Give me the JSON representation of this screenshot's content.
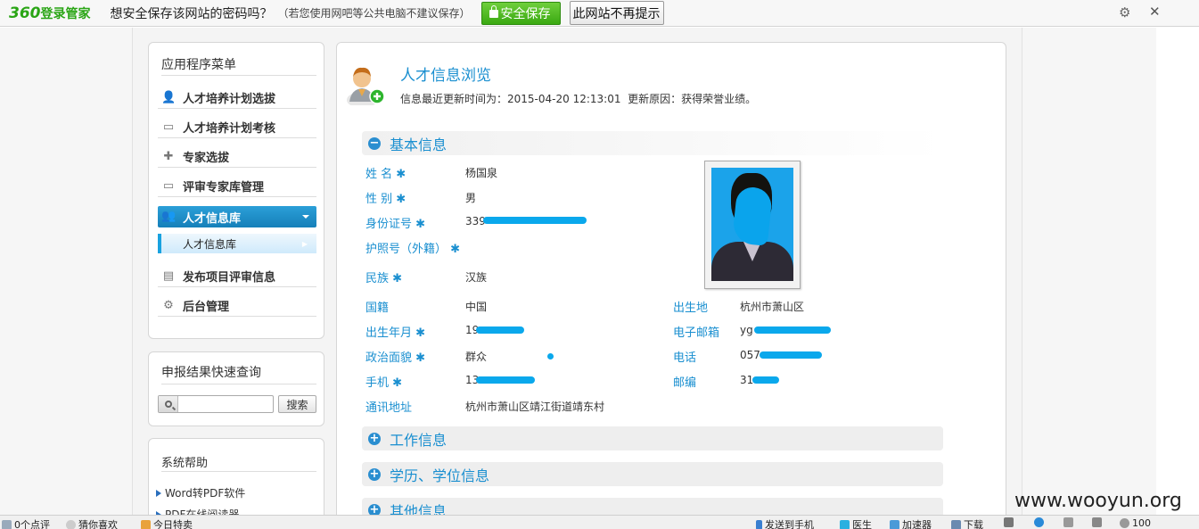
{
  "password_bar": {
    "logo_number": "360",
    "logo_text": "登录管家",
    "question": "想安全保存该网站的密码吗？",
    "hint": "（若您使用网吧等公共电脑不建议保存）",
    "save_button": "安全保存",
    "never_button": "此网站不再提示"
  },
  "sidebar": {
    "menu_title": "应用程序菜单",
    "items": [
      {
        "label": "人才培养计划选拔",
        "icon": "user-icon"
      },
      {
        "label": "人才培养计划考核",
        "icon": "monitor-icon"
      },
      {
        "label": "专家选拔",
        "icon": "puzzle-icon"
      },
      {
        "label": "评审专家库管理",
        "icon": "monitor-icon"
      },
      {
        "label": "人才信息库",
        "icon": "users-icon",
        "active": true
      },
      {
        "label": "发布项目评审信息",
        "icon": "document-icon"
      },
      {
        "label": "后台管理",
        "icon": "gear-icon"
      }
    ],
    "sub_item": "人才信息库",
    "query_title": "申报结果快速查询",
    "search_placeholder": "",
    "search_button": "搜索",
    "help_title": "系统帮助",
    "help_links": [
      "Word转PDF软件",
      "PDF在线阅读器"
    ]
  },
  "main": {
    "title": "人才信息浏览",
    "update_time_label": "信息最近更新时间为：",
    "update_time": "2015-04-20 12:13:01",
    "update_reason_label": "更新原因：",
    "update_reason": "获得荣誉业绩。",
    "sections": {
      "basic": "基本信息",
      "work": "工作信息",
      "education": "学历、学位信息",
      "other": "其他信息"
    },
    "fields": {
      "name": {
        "label": "姓 名",
        "value": "杨国泉"
      },
      "gender": {
        "label": "性 别",
        "value": "男"
      },
      "id_number": {
        "label": "身份证号",
        "value": "339"
      },
      "passport": {
        "label": "护照号（外籍）",
        "value": ""
      },
      "ethnicity": {
        "label": "民族",
        "value": "汉族"
      },
      "nationality": {
        "label": "国籍",
        "value": "中国"
      },
      "birth_date": {
        "label": "出生年月",
        "value": "19"
      },
      "political": {
        "label": "政治面貌",
        "value": "群众"
      },
      "mobile": {
        "label": "手机",
        "value": "13"
      },
      "address": {
        "label": "通讯地址",
        "value": "杭州市萧山区靖江街道靖东村"
      },
      "birthplace": {
        "label": "出生地",
        "value": "杭州市萧山区"
      },
      "email": {
        "label": "电子邮箱",
        "value": "yg"
      },
      "phone": {
        "label": "电话",
        "value": "057"
      },
      "postcode": {
        "label": "邮编",
        "value": "31"
      }
    }
  },
  "statusbar": {
    "comments": "0个点评",
    "guess": "猜你喜欢",
    "today": "今日特卖",
    "send_phone": "发送到手机",
    "doctor": "医生",
    "accelerator": "加速器",
    "download": "下载",
    "zoom": "100"
  },
  "watermark": "www.wooyun.org",
  "colors": {
    "accent": "#1a8fd0",
    "menu_active": "#157fb9",
    "save_green": "#3aa912",
    "redaction": "#0aa8ec"
  }
}
